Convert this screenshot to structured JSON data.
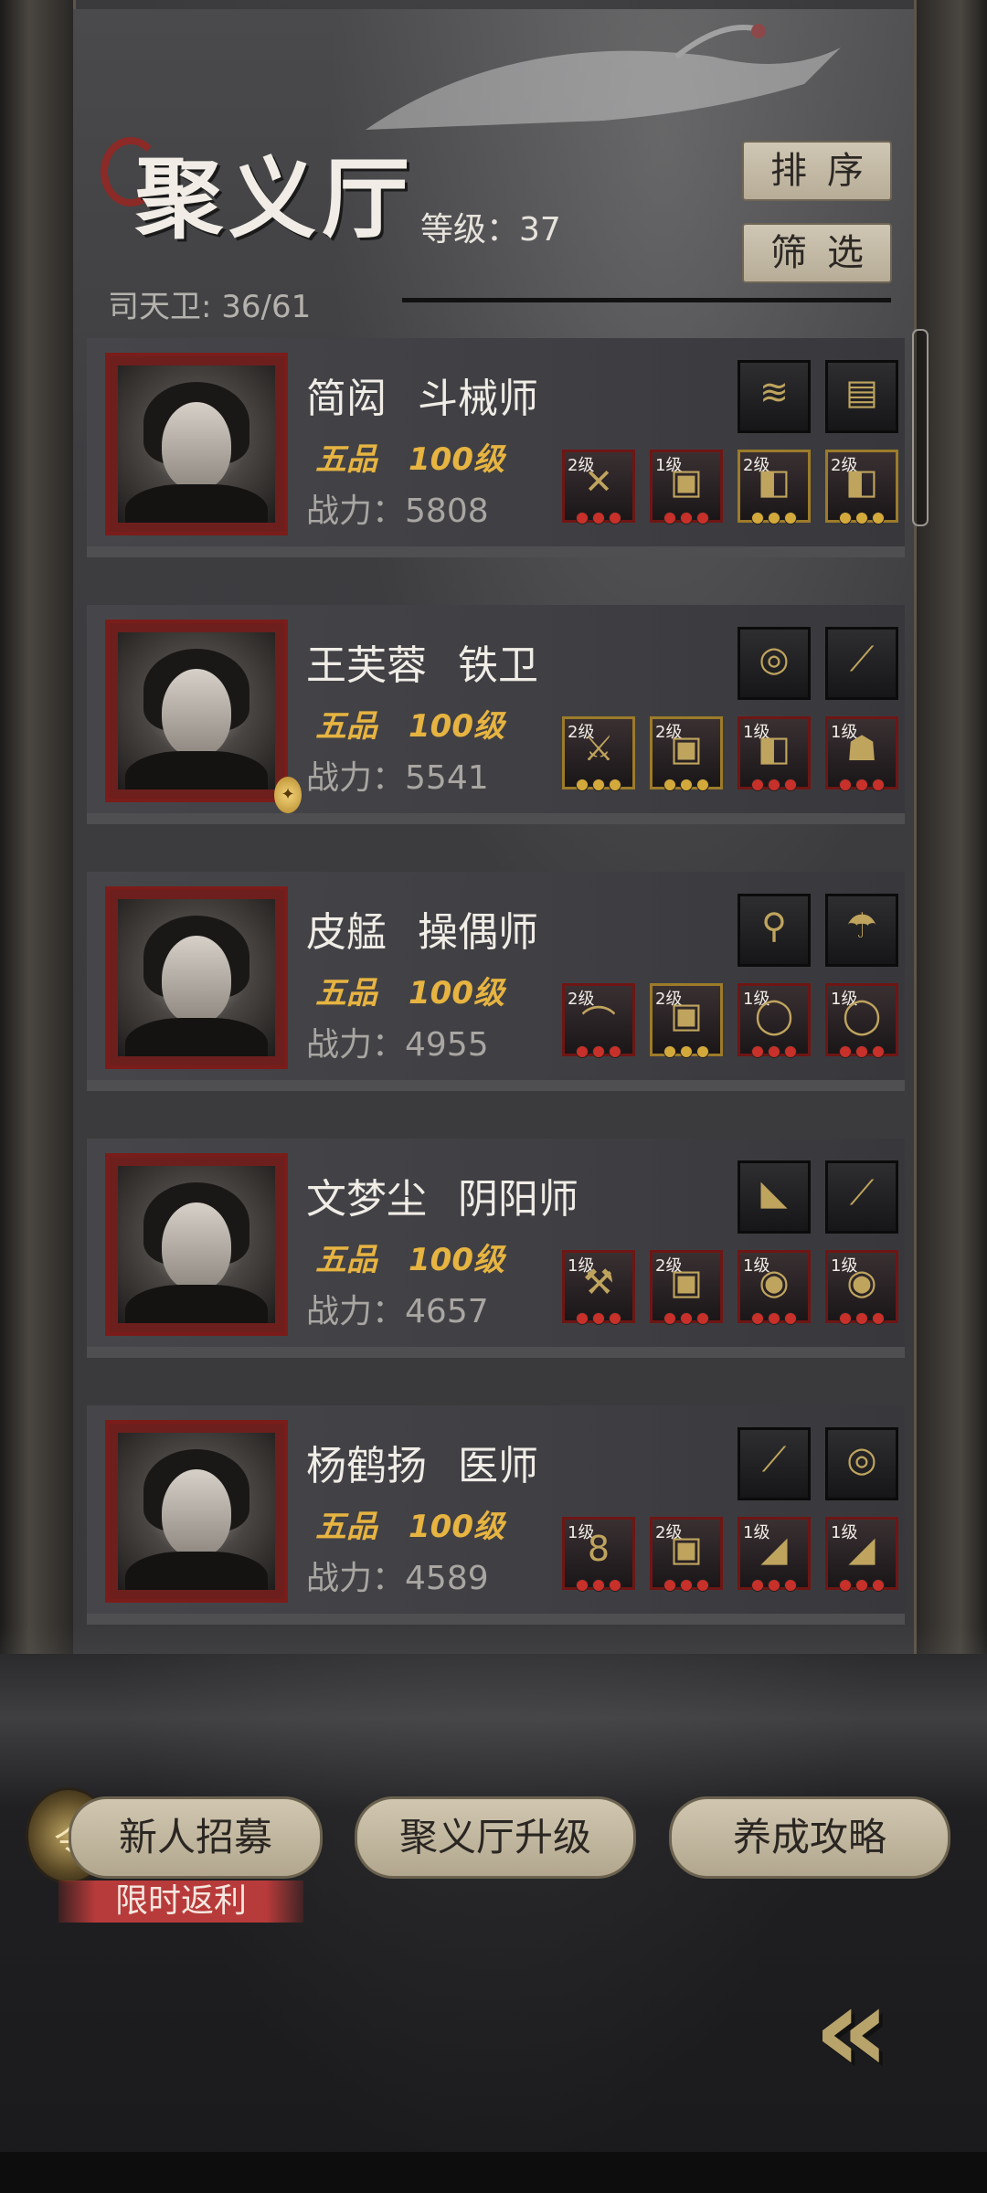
{
  "header": {
    "title": "聚义厅",
    "level_label": "等级：",
    "level_value": "37",
    "guard_label": "司天卫: ",
    "guard_value": "36/61",
    "sort_label": "排序",
    "filter_label": "筛选"
  },
  "members": [
    {
      "name": "简闳",
      "role": "斗械师",
      "rank": "五品",
      "level": "100级",
      "power_label": "战力：",
      "power": "5808",
      "top_gear": [
        "comb-icon",
        "chest-icon"
      ],
      "gear": [
        {
          "lvl": "2级",
          "icon": "crossbow-icon",
          "rarity": "red"
        },
        {
          "lvl": "1级",
          "icon": "armor-icon",
          "rarity": "red"
        },
        {
          "lvl": "2级",
          "icon": "boots-icon",
          "rarity": "gold"
        },
        {
          "lvl": "2级",
          "icon": "boots-icon",
          "rarity": "gold"
        }
      ]
    },
    {
      "name": "王芙蓉",
      "role": "铁卫",
      "rank": "五品",
      "level": "100级",
      "power_label": "战力：",
      "power": "5541",
      "top_gear": [
        "plate-icon",
        "hairpin-icon"
      ],
      "gear": [
        {
          "lvl": "2级",
          "icon": "twin-blade-icon",
          "rarity": "gold"
        },
        {
          "lvl": "2级",
          "icon": "armor-icon",
          "rarity": "gold"
        },
        {
          "lvl": "1级",
          "icon": "boots-icon",
          "rarity": "red"
        },
        {
          "lvl": "1级",
          "icon": "mask-icon",
          "rarity": "red"
        }
      ]
    },
    {
      "name": "皮艋",
      "role": "操偶师",
      "rank": "五品",
      "level": "100级",
      "power_label": "战力：",
      "power": "4955",
      "top_gear": [
        "rattle-icon",
        "fungus-icon"
      ],
      "gear": [
        {
          "lvl": "2级",
          "icon": "bow-icon",
          "rarity": "red"
        },
        {
          "lvl": "2级",
          "icon": "armor-icon",
          "rarity": "gold"
        },
        {
          "lvl": "1级",
          "icon": "bracelet-icon",
          "rarity": "red"
        },
        {
          "lvl": "1级",
          "icon": "bracelet-icon",
          "rarity": "red"
        }
      ]
    },
    {
      "name": "文梦尘",
      "role": "阴阳师",
      "rank": "五品",
      "level": "100级",
      "power_label": "战力：",
      "power": "4657",
      "top_gear": [
        "fan-icon",
        "hairpin-icon"
      ],
      "gear": [
        {
          "lvl": "1级",
          "icon": "axe-icon",
          "rarity": "red"
        },
        {
          "lvl": "2级",
          "icon": "armor-icon",
          "rarity": "red"
        },
        {
          "lvl": "1级",
          "icon": "pendant-icon",
          "rarity": "red"
        },
        {
          "lvl": "1级",
          "icon": "pendant-icon",
          "rarity": "red"
        }
      ]
    },
    {
      "name": "杨鹤扬",
      "role": "医师",
      "rank": "五品",
      "level": "100级",
      "power_label": "战力：",
      "power": "4589",
      "top_gear": [
        "hairpin-icon",
        "plate-icon"
      ],
      "gear": [
        {
          "lvl": "1级",
          "icon": "gourd-icon",
          "rarity": "red"
        },
        {
          "lvl": "2级",
          "icon": "armor-icon",
          "rarity": "red"
        },
        {
          "lvl": "1级",
          "icon": "robe-icon",
          "rarity": "red"
        },
        {
          "lvl": "1级",
          "icon": "robe-icon",
          "rarity": "red"
        }
      ]
    }
  ],
  "footer": {
    "recruit_label": "新人招募",
    "recruit_badge": "令",
    "promo_label": "限时返利",
    "upgrade_label": "聚义厅升级",
    "guide_label": "养成攻略",
    "back_glyph": "«"
  },
  "colors": {
    "accent_gold": "#e7b441",
    "card_bg": "#46464a",
    "frame_red": "#7a1d1a",
    "button_beige": "#cfc6b4"
  }
}
